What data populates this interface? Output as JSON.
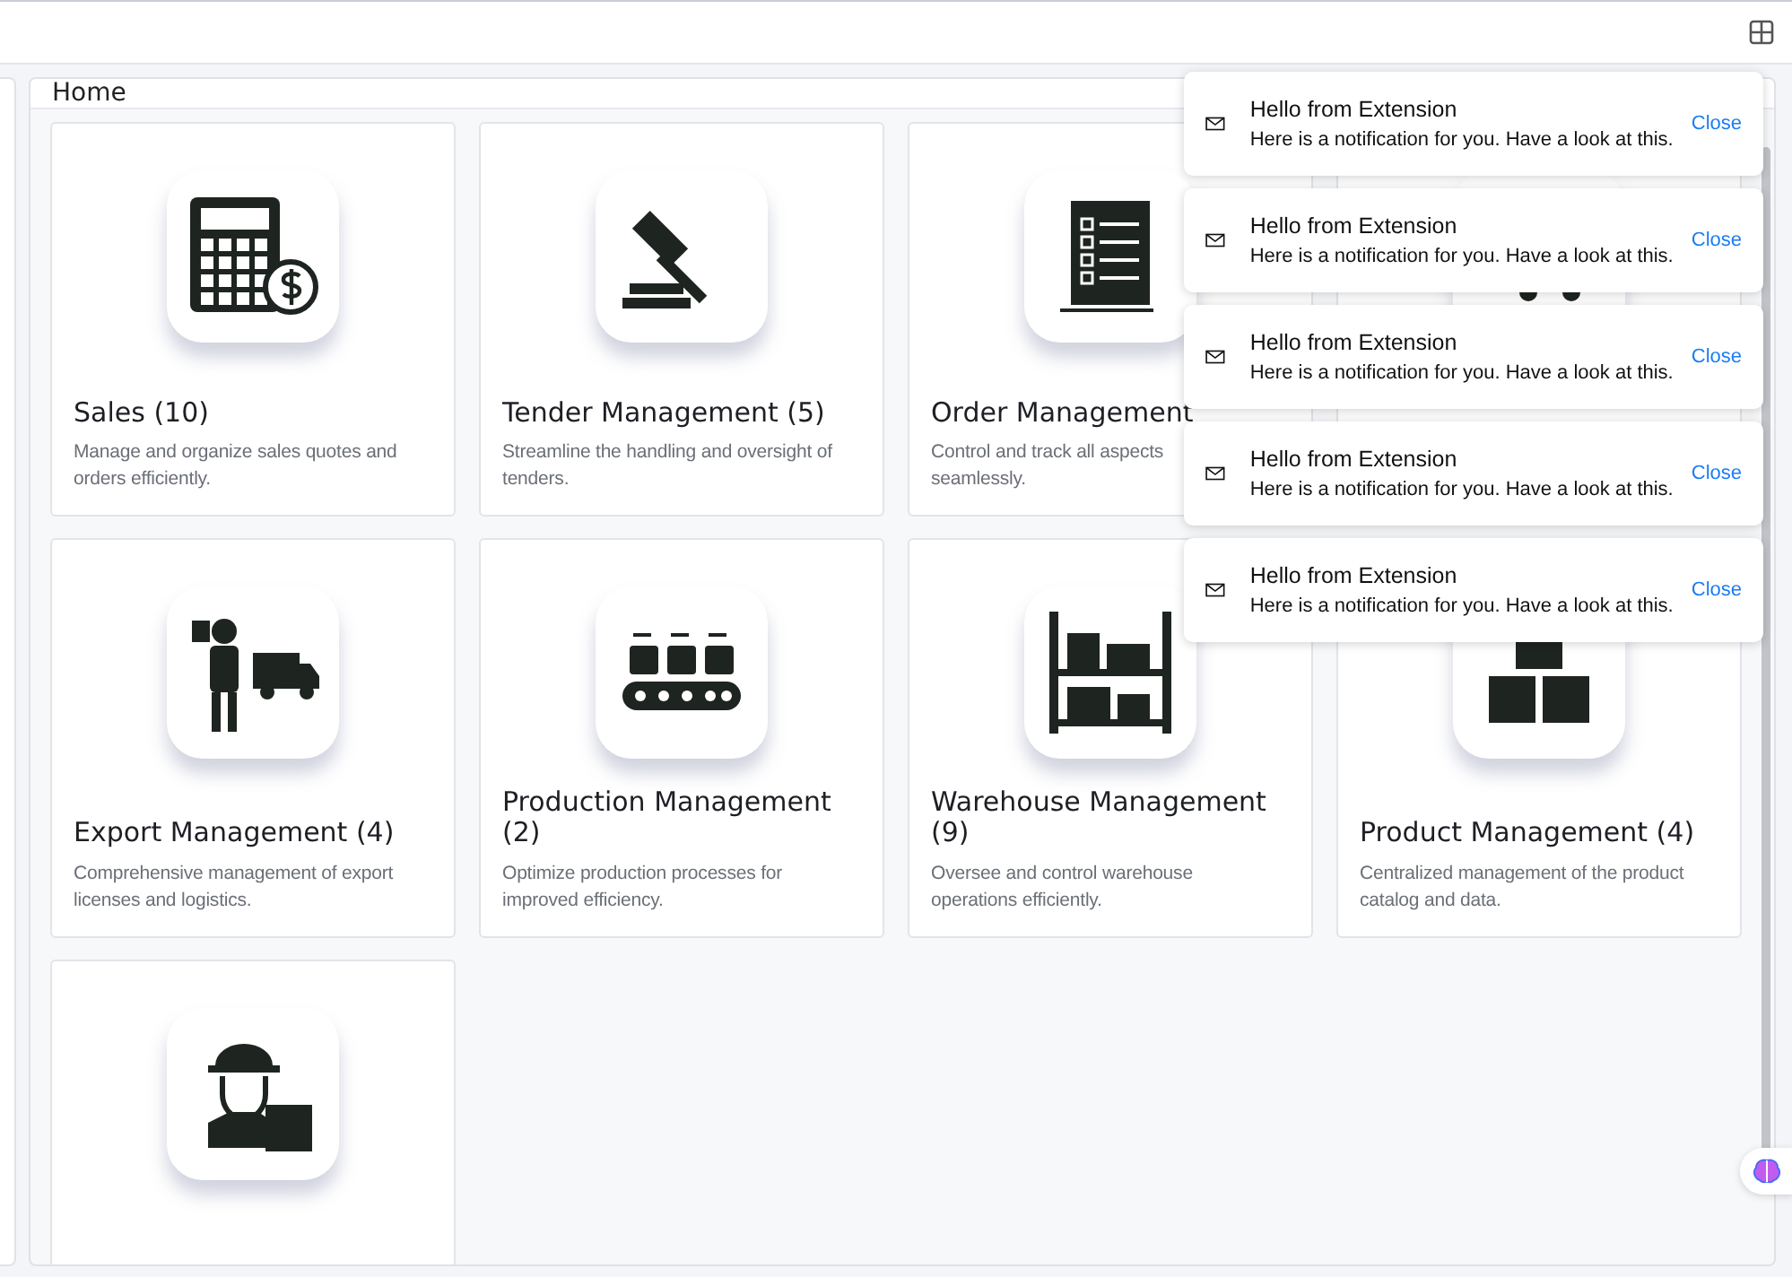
{
  "page": {
    "title": "Home"
  },
  "cards": [
    {
      "kind": "calculator",
      "title": "Sales (10)",
      "description": [
        "Manage and organize sales quotes and",
        "orders efficiently."
      ]
    },
    {
      "kind": "gavel",
      "title": "Tender Management (5)",
      "description": [
        "Streamline the handling and oversight of",
        "tenders."
      ]
    },
    {
      "kind": "checklist",
      "title": "Order Management",
      "description": [
        "Control and track all aspects",
        "seamlessly."
      ]
    },
    {
      "kind": "cart"
    },
    {
      "kind": "delivery",
      "title": "Export Management (4)",
      "description": [
        "Comprehensive management of export",
        "licenses and logistics."
      ]
    },
    {
      "kind": "conveyor",
      "title": "Production Management (2)",
      "description": [
        "Optimize production processes for",
        "improved efficiency."
      ]
    },
    {
      "kind": "shelves",
      "title": "Warehouse Management (9)",
      "description": [
        "Oversee and control warehouse",
        "operations efficiently."
      ]
    },
    {
      "kind": "boxes",
      "title": "Product Management (4)",
      "description": [
        "Centralized management of the product",
        "catalog and data."
      ]
    },
    {
      "kind": "courier"
    }
  ],
  "notifications": [
    {
      "title": "Hello from Extension",
      "message": "Here is a notification for you. Have a look at this.",
      "action": "Close"
    },
    {
      "title": "Hello from Extension",
      "message": "Here is a notification for you. Have a look at this.",
      "action": "Close"
    },
    {
      "title": "Hello from Extension",
      "message": "Here is a notification for you. Have a look at this.",
      "action": "Close"
    },
    {
      "title": "Hello from Extension",
      "message": "Here is a notification for you. Have a look at this.",
      "action": "Close"
    },
    {
      "title": "Hello from Extension",
      "message": "Here is a notification for you. Have a look at this.",
      "action": "Close"
    }
  ]
}
